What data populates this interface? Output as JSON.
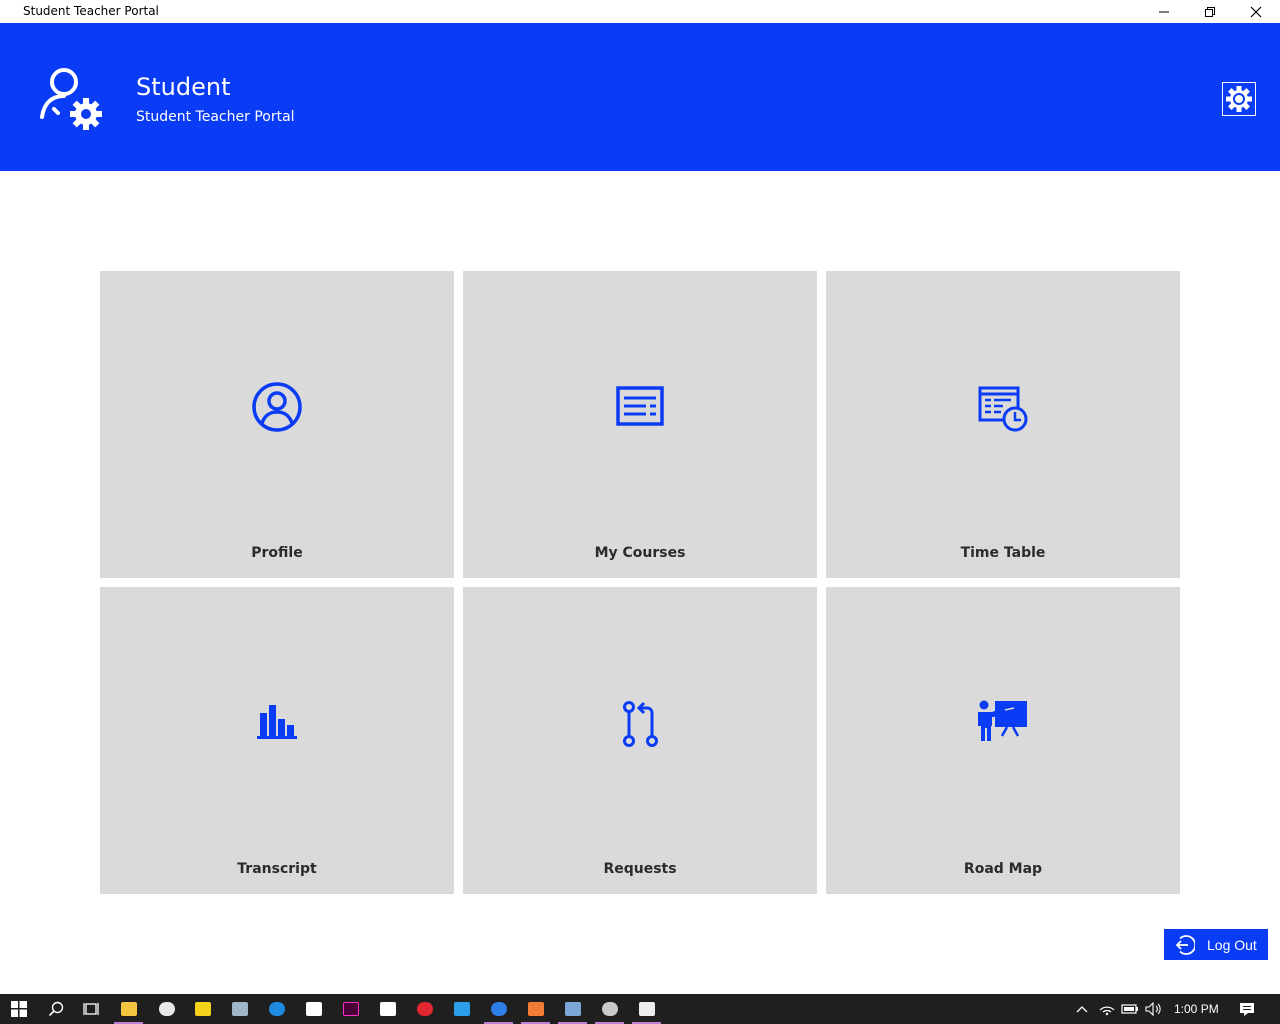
{
  "window": {
    "title": "Student Teacher Portal"
  },
  "header": {
    "title": "Student",
    "subtitle": "Student Teacher Portal",
    "accent_color": "#0a3cf5",
    "logo_icon": "user-gear-icon",
    "settings_icon": "gear-icon"
  },
  "tiles": [
    {
      "label": "Profile",
      "icon": "user-circle-icon"
    },
    {
      "label": "My Courses",
      "icon": "course-list-icon"
    },
    {
      "label": "Time Table",
      "icon": "calendar-clock-icon"
    },
    {
      "label": "Transcript",
      "icon": "bar-chart-icon"
    },
    {
      "label": "Requests",
      "icon": "pull-request-icon"
    },
    {
      "label": "Road Map",
      "icon": "presenter-board-icon"
    }
  ],
  "logout": {
    "label": "Log Out",
    "icon": "logout-arrow-icon"
  },
  "taskbar": {
    "apps": [
      "start-icon",
      "search-icon",
      "task-view-icon",
      "file-explorer-icon",
      "paint-icon",
      "sticky-notes-icon",
      "photos-icon",
      "edge-icon",
      "mail-icon",
      "adobe-xd-icon",
      "store-icon",
      "opera-icon",
      "vscode-icon",
      "firefox-icon",
      "xampp-icon",
      "virtualbox-icon",
      "paint3d-icon",
      "app-icon"
    ],
    "time": "1:00 PM"
  }
}
